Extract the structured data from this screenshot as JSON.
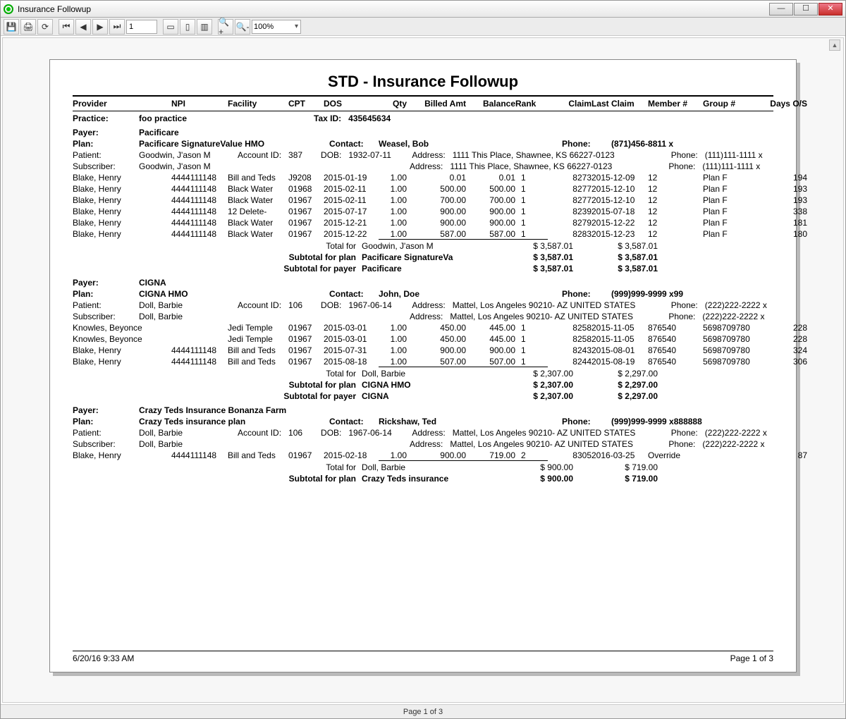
{
  "window": {
    "title": "Insurance Followup"
  },
  "toolbar": {
    "page_input": "1",
    "zoom": "100%"
  },
  "viewer": {
    "scroll_label": "▲"
  },
  "report": {
    "title": "STD - Insurance Followup",
    "headers": [
      "Provider",
      "NPI",
      "Facility",
      "CPT",
      "DOS",
      "Qty",
      "Billed Amt",
      "Balance",
      "Rank",
      "Claim",
      "Last Claim",
      "Member #",
      "Group #",
      "Days O/S"
    ],
    "practice_label": "Practice:",
    "practice": "foo practice",
    "taxid_label": "Tax ID:",
    "taxid": "435645634",
    "footer_time": "6/20/16 9:33 AM",
    "footer_page": "Page 1 of  3"
  },
  "labels": {
    "payer": "Payer:",
    "plan": "Plan:",
    "contact": "Contact:",
    "phone": "Phone:",
    "patient": "Patient:",
    "subscriber": "Subscriber:",
    "account": "Account ID:",
    "dob": "DOB:",
    "address": "Address:",
    "total_for": "Total for",
    "sub_plan": "Subtotal for plan",
    "sub_payer": "Subtotal for payer"
  },
  "payers": [
    {
      "name": "Pacificare",
      "plan": "Pacificare SignatureValue HMO",
      "contact": "Weasel, Bob",
      "phone": "(871)456-8811 x",
      "patient": {
        "name": "Goodwin, J'ason M",
        "account": "387",
        "dob": "1932-07-11",
        "address": "1111 This Place, Shawnee, KS 66227-0123",
        "phone": "(111)111-1111 x"
      },
      "subscriber": {
        "name": "Goodwin, J'ason M",
        "address": "1111 This Place, Shawnee, KS 66227-0123",
        "phone": "(111)111-1111 x"
      },
      "rows": [
        {
          "provider": "Blake, Henry",
          "npi": "4444111148",
          "facility": "Bill and Teds",
          "cpt": "J9208",
          "dos": "2015-01-19",
          "qty": "1.00",
          "billed": "0.01",
          "balance": "0.01",
          "rank": "1",
          "claim": "8273",
          "last": "2015-12-09",
          "member": "12",
          "group": "Plan F",
          "days": "194"
        },
        {
          "provider": "Blake, Henry",
          "npi": "4444111148",
          "facility": "Black Water",
          "cpt": "01968",
          "dos": "2015-02-11",
          "qty": "1.00",
          "billed": "500.00",
          "balance": "500.00",
          "rank": "1",
          "claim": "8277",
          "last": "2015-12-10",
          "member": "12",
          "group": "Plan F",
          "days": "193"
        },
        {
          "provider": "Blake, Henry",
          "npi": "4444111148",
          "facility": "Black Water",
          "cpt": "01967",
          "dos": "2015-02-11",
          "qty": "1.00",
          "billed": "700.00",
          "balance": "700.00",
          "rank": "1",
          "claim": "8277",
          "last": "2015-12-10",
          "member": "12",
          "group": "Plan F",
          "days": "193"
        },
        {
          "provider": "Blake, Henry",
          "npi": "4444111148",
          "facility": "12 Delete-",
          "cpt": "01967",
          "dos": "2015-07-17",
          "qty": "1.00",
          "billed": "900.00",
          "balance": "900.00",
          "rank": "1",
          "claim": "8239",
          "last": "2015-07-18",
          "member": "12",
          "group": "Plan F",
          "days": "338"
        },
        {
          "provider": "Blake, Henry",
          "npi": "4444111148",
          "facility": "Black Water",
          "cpt": "01967",
          "dos": "2015-12-21",
          "qty": "1.00",
          "billed": "900.00",
          "balance": "900.00",
          "rank": "1",
          "claim": "8279",
          "last": "2015-12-22",
          "member": "12",
          "group": "Plan F",
          "days": "181"
        },
        {
          "provider": "Blake, Henry",
          "npi": "4444111148",
          "facility": "Black Water",
          "cpt": "01967",
          "dos": "2015-12-22",
          "qty": "1.00",
          "billed": "587.00",
          "balance": "587.00",
          "rank": "1",
          "claim": "8283",
          "last": "2015-12-23",
          "member": "12",
          "group": "Plan F",
          "days": "180"
        }
      ],
      "total_for_name": "Goodwin, J'ason M",
      "total_billed": "$ 3,587.01",
      "total_balance": "$ 3,587.01",
      "sub_plan_name": "Pacificare SignatureVa",
      "sub_plan_billed": "$ 3,587.01",
      "sub_plan_balance": "$ 3,587.01",
      "sub_payer_name": "Pacificare",
      "sub_payer_billed": "$ 3,587.01",
      "sub_payer_balance": "$ 3,587.01"
    },
    {
      "name": "CIGNA",
      "plan": "CIGNA HMO",
      "contact": "John, Doe",
      "phone": "(999)999-9999 x99",
      "patient": {
        "name": "Doll, Barbie",
        "account": "106",
        "dob": "1967-06-14",
        "address": "Mattel, Los Angeles 90210- AZ UNITED STATES",
        "phone": "(222)222-2222 x"
      },
      "subscriber": {
        "name": "Doll, Barbie",
        "address": "Mattel, Los Angeles 90210- AZ UNITED STATES",
        "phone": "(222)222-2222 x"
      },
      "rows": [
        {
          "provider": "Knowles, Beyonce",
          "npi": "",
          "facility": "Jedi Temple",
          "cpt": "01967",
          "dos": "2015-03-01",
          "qty": "1.00",
          "billed": "450.00",
          "balance": "445.00",
          "rank": "1",
          "claim": "8258",
          "last": "2015-11-05",
          "member": "876540",
          "group": "5698709780",
          "days": "228"
        },
        {
          "provider": "Knowles, Beyonce",
          "npi": "",
          "facility": "Jedi Temple",
          "cpt": "01967",
          "dos": "2015-03-01",
          "qty": "1.00",
          "billed": "450.00",
          "balance": "445.00",
          "rank": "1",
          "claim": "8258",
          "last": "2015-11-05",
          "member": "876540",
          "group": "5698709780",
          "days": "228"
        },
        {
          "provider": "Blake, Henry",
          "npi": "4444111148",
          "facility": "Bill and Teds",
          "cpt": "01967",
          "dos": "2015-07-31",
          "qty": "1.00",
          "billed": "900.00",
          "balance": "900.00",
          "rank": "1",
          "claim": "8243",
          "last": "2015-08-01",
          "member": "876540",
          "group": "5698709780",
          "days": "324"
        },
        {
          "provider": "Blake, Henry",
          "npi": "4444111148",
          "facility": "Bill and Teds",
          "cpt": "01967",
          "dos": "2015-08-18",
          "qty": "1.00",
          "billed": "507.00",
          "balance": "507.00",
          "rank": "1",
          "claim": "8244",
          "last": "2015-08-19",
          "member": "876540",
          "group": "5698709780",
          "days": "306"
        }
      ],
      "total_for_name": "Doll, Barbie",
      "total_billed": "$ 2,307.00",
      "total_balance": "$ 2,297.00",
      "sub_plan_name": "CIGNA HMO",
      "sub_plan_billed": "$ 2,307.00",
      "sub_plan_balance": "$ 2,297.00",
      "sub_payer_name": "CIGNA",
      "sub_payer_billed": "$ 2,307.00",
      "sub_payer_balance": "$ 2,297.00"
    },
    {
      "name": "Crazy Teds Insurance Bonanza Farm",
      "plan": "Crazy Teds insurance plan",
      "contact": "Rickshaw, Ted",
      "phone": "(999)999-9999 x888888",
      "patient": {
        "name": "Doll, Barbie",
        "account": "106",
        "dob": "1967-06-14",
        "address": "Mattel, Los Angeles 90210- AZ UNITED STATES",
        "phone": "(222)222-2222 x"
      },
      "subscriber": {
        "name": "Doll, Barbie",
        "address": "Mattel, Los Angeles 90210- AZ UNITED STATES",
        "phone": "(222)222-2222 x"
      },
      "rows": [
        {
          "provider": "Blake, Henry",
          "npi": "4444111148",
          "facility": "Bill and Teds",
          "cpt": "01967",
          "dos": "2015-02-18",
          "qty": "1.00",
          "billed": "900.00",
          "balance": "719.00",
          "rank": "2",
          "claim": "8305",
          "last": "2016-03-25",
          "member": "Override",
          "group": "",
          "days": "87"
        }
      ],
      "total_for_name": "Doll, Barbie",
      "total_billed": "$ 900.00",
      "total_balance": "$ 719.00",
      "sub_plan_name": "Crazy Teds insurance",
      "sub_plan_billed": "$ 900.00",
      "sub_plan_balance": "$ 719.00"
    }
  ],
  "statusbar": {
    "text": "Page 1 of 3"
  }
}
